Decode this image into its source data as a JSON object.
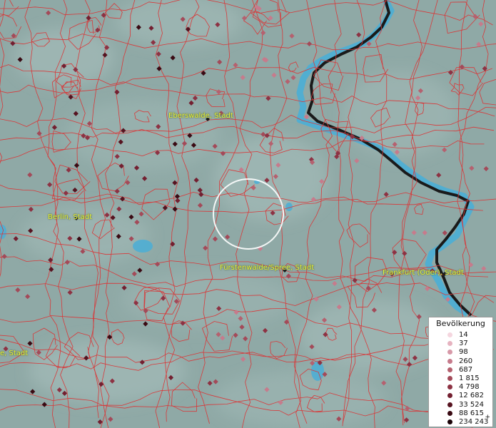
{
  "map": {
    "colors": {
      "background": "#8fa9a6",
      "boundaries": "#d8393a",
      "water": "#4aaed6",
      "border_line": "#1a1a1a",
      "selection_circle": "#ffffff"
    },
    "labels": {
      "eberswalde": "Eberswalde, Stadt",
      "berlin": "Berlin, Stadt",
      "fuerstenwalde": "Fürstenwalde/Spree, Stadt",
      "frankfurt": "Frankfurt (Oder), Stadt",
      "left_cut": "e, Stadt"
    }
  },
  "legend": {
    "title": "Bevölkerung",
    "items": [
      {
        "label": "14",
        "color": "#f5d6df"
      },
      {
        "label": "37",
        "color": "#e6b3c0"
      },
      {
        "label": "98",
        "color": "#d799a8"
      },
      {
        "label": "260",
        "color": "#c67b8c"
      },
      {
        "label": "687",
        "color": "#b5616f"
      },
      {
        "label": "1 815",
        "color": "#a34a59"
      },
      {
        "label": "4 798",
        "color": "#8d3243"
      },
      {
        "label": "12 682",
        "color": "#731f30"
      },
      {
        "label": "33 524",
        "color": "#561320"
      },
      {
        "label": "88 615",
        "color": "#3a0a13"
      },
      {
        "label": "234 243",
        "color": "#1a0207"
      }
    ],
    "plus": "+"
  }
}
